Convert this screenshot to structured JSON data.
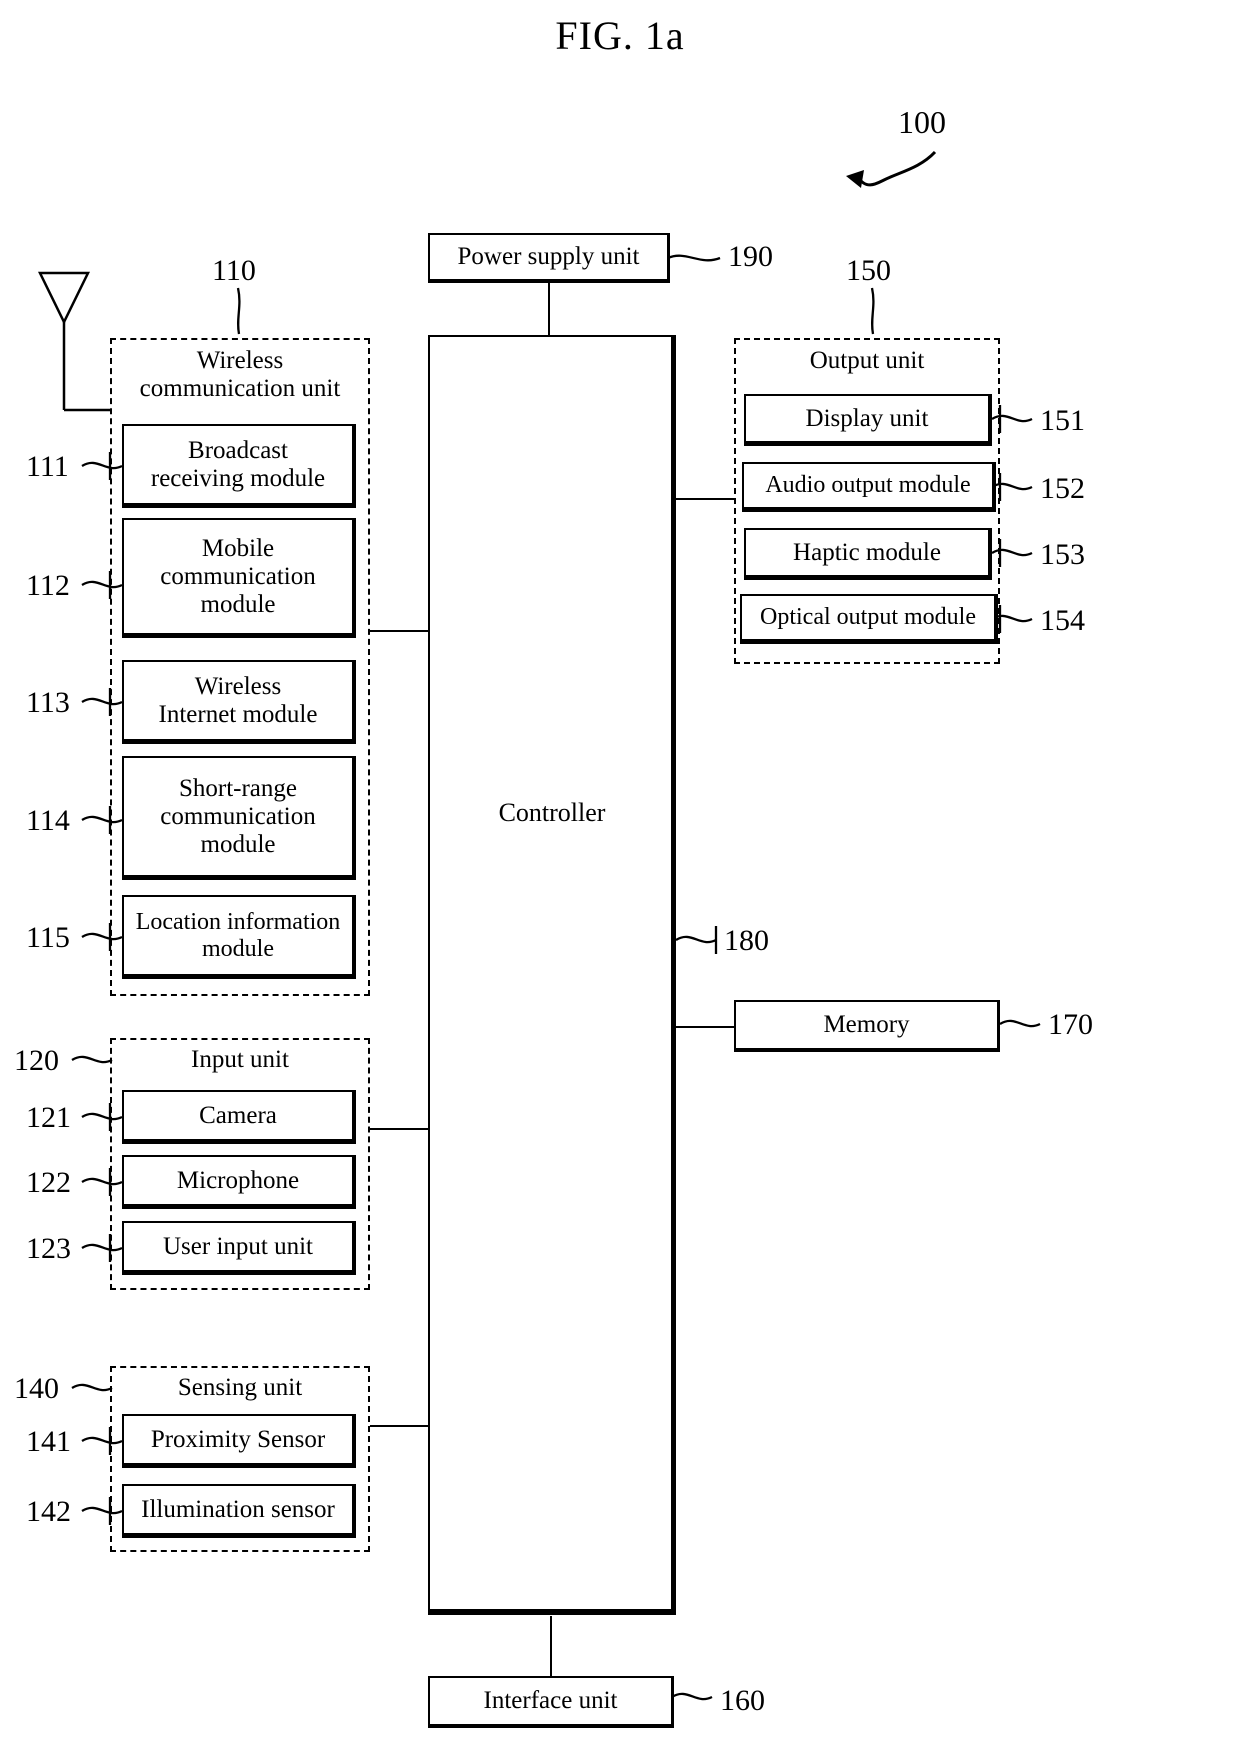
{
  "figure": {
    "title": "FIG. 1a",
    "device_ref": "100"
  },
  "power_supply": {
    "label": "Power supply unit",
    "ref": "190"
  },
  "controller": {
    "label": "Controller",
    "ref": "180"
  },
  "memory": {
    "label": "Memory",
    "ref": "170"
  },
  "interface": {
    "label": "Interface unit",
    "ref": "160"
  },
  "wireless_unit": {
    "title_line1": "Wireless",
    "title_line2": "communication unit",
    "ref": "110",
    "modules": [
      {
        "label_line1": "Broadcast",
        "label_line2": "receiving module",
        "label_line3": "",
        "ref": "111"
      },
      {
        "label_line1": "Mobile",
        "label_line2": "communication",
        "label_line3": "module",
        "ref": "112"
      },
      {
        "label_line1": "Wireless",
        "label_line2": "Internet module",
        "label_line3": "",
        "ref": "113"
      },
      {
        "label_line1": "Short-range",
        "label_line2": "communication",
        "label_line3": "module",
        "ref": "114"
      },
      {
        "label_line1": "Location information",
        "label_line2": "module",
        "label_line3": "",
        "ref": "115"
      }
    ]
  },
  "input_unit": {
    "title": "Input unit",
    "ref": "120",
    "modules": [
      {
        "label": "Camera",
        "ref": "121"
      },
      {
        "label": "Microphone",
        "ref": "122"
      },
      {
        "label": "User input unit",
        "ref": "123"
      }
    ]
  },
  "sensing_unit": {
    "title": "Sensing unit",
    "ref": "140",
    "modules": [
      {
        "label": "Proximity Sensor",
        "ref": "141"
      },
      {
        "label": "Illumination sensor",
        "ref": "142"
      }
    ]
  },
  "output_unit": {
    "title": "Output unit",
    "ref": "150",
    "modules": [
      {
        "label": "Display unit",
        "ref": "151"
      },
      {
        "label": "Audio output module",
        "ref": "152"
      },
      {
        "label": "Haptic module",
        "ref": "153"
      },
      {
        "label": "Optical output module",
        "ref": "154"
      }
    ]
  },
  "icons": {
    "antenna": "antenna-icon",
    "device_arrow": "curved-arrow-icon"
  }
}
